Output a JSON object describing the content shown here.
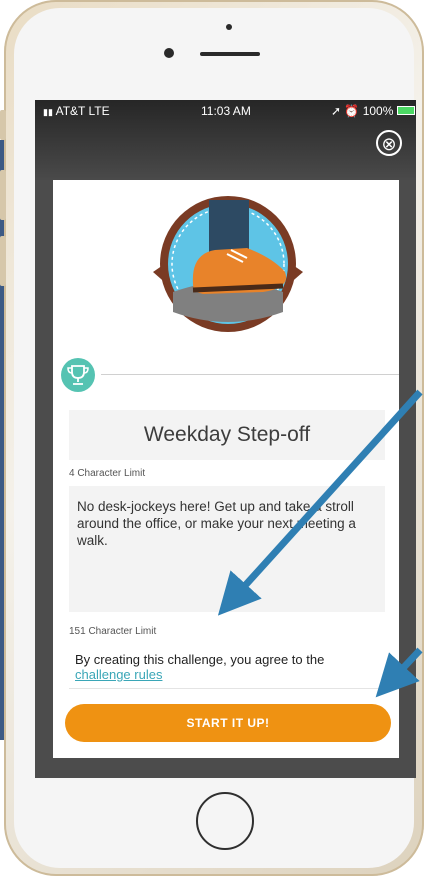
{
  "status_bar": {
    "carrier": "AT&T  LTE",
    "time": "11:03 AM",
    "battery": "100%"
  },
  "modal": {
    "close_label": "⊗",
    "title": "Weekday Step-off",
    "title_limit": "4 Character Limit",
    "description": "No desk-jockeys here! Get up and take a stroll around the office, or make your next meeting a walk.",
    "description_limit": "151 Character Limit",
    "terms_text": "By creating this challenge, you agree to the",
    "terms_link": "challenge rules",
    "cta_label": "START IT UP!"
  },
  "colors": {
    "accent": "#ef9212",
    "teal": "#55c3b2",
    "arrow": "#2f7fb3"
  }
}
